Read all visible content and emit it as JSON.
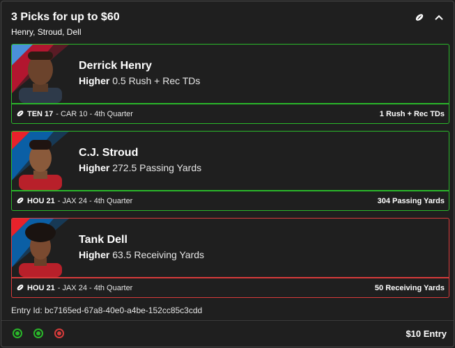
{
  "header": {
    "title": "3 Picks for up to $60",
    "subtitle": "Henry, Stroud, Dell"
  },
  "picks": [
    {
      "name": "Derrick Henry",
      "direction": "Higher",
      "line": "0.5 Rush + Rec TDs",
      "team": "TEN 17",
      "game": "- CAR 10 - 4th Quarter",
      "result": "1 Rush + Rec TDs",
      "status": "win",
      "status_color": "#2ab82a",
      "stripe_colors": [
        "#4a90d9",
        "#c8102e"
      ]
    },
    {
      "name": "C.J. Stroud",
      "direction": "Higher",
      "line": "272.5 Passing Yards",
      "team": "HOU 21",
      "game": "- JAX 24 - 4th Quarter",
      "result": "304 Passing Yards",
      "status": "win",
      "status_color": "#2ab82a",
      "stripe_colors": [
        "#e8222b",
        "#0b5fa5"
      ]
    },
    {
      "name": "Tank Dell",
      "direction": "Higher",
      "line": "63.5 Receiving Yards",
      "team": "HOU 21",
      "game": "- JAX 24 - 4th Quarter",
      "result": "50 Receiving Yards",
      "status": "loss",
      "status_color": "#d83b3b",
      "stripe_colors": [
        "#e8222b",
        "#0b5fa5"
      ]
    }
  ],
  "entry": {
    "id_label": "Entry Id: bc7165ed-67a8-40e0-a4be-152cc85c3cdd",
    "amount": "$10 Entry"
  },
  "status_dots": [
    {
      "state": "win",
      "color": "#2ab82a"
    },
    {
      "state": "win",
      "color": "#2ab82a"
    },
    {
      "state": "loss",
      "color": "#d83b3b"
    }
  ],
  "icons": {
    "football": "football-icon",
    "collapse": "chevron-up-icon"
  }
}
